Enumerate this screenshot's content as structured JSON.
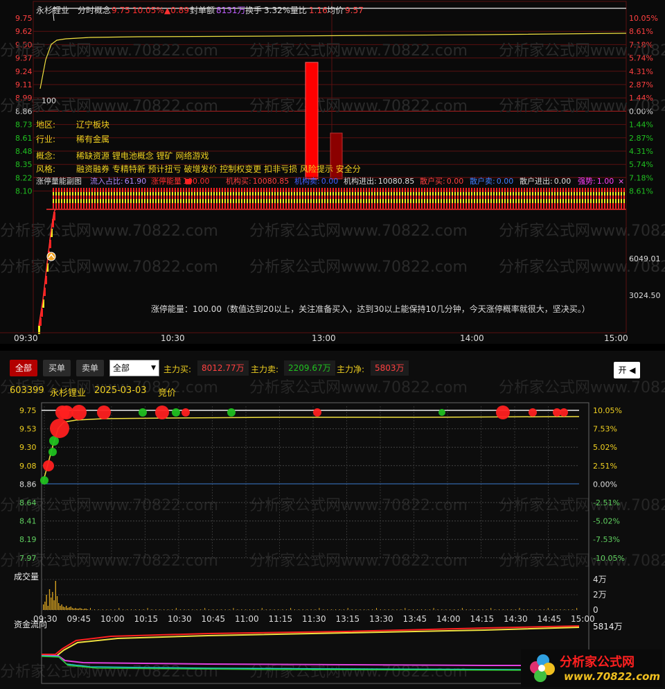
{
  "top": {
    "stock_name": "永杉锂业",
    "mode_label": "分时概念",
    "price": "9.75",
    "pct": "10.05%",
    "change": "▲0.89",
    "seal_label": "封单额",
    "seal_value": "8131万",
    "turnover_label": "换手",
    "turnover_value": "3.32%",
    "vol_ratio_label": "量比",
    "vol_ratio_value": "1.16",
    "avg_label": "均价",
    "avg_value": "9.57",
    "left_ticks": [
      "9.75",
      "9.62",
      "9.50",
      "9.37",
      "9.24",
      "9.11",
      "8.99",
      "8.86",
      "8.73",
      "8.61",
      "8.48",
      "8.35",
      "8.22",
      "8.10"
    ],
    "right_ticks": [
      "10.05%",
      "8.61%",
      "7.18%",
      "5.74%",
      "4.31%",
      "2.87%",
      "1.44%",
      "0.00%",
      "1.44%",
      "2.87%",
      "4.31%",
      "5.74%",
      "7.18%",
      "8.61%"
    ],
    "label_100": "100",
    "info_rows": [
      {
        "key": "地区:",
        "value": "辽宁板块"
      },
      {
        "key": "行业:",
        "value": "稀有金属"
      },
      {
        "key": "概念:",
        "value": "稀缺资源 锂电池概念 锂矿 网络游戏"
      },
      {
        "key": "风格:",
        "value": "融资融券 专精特新 预计扭亏 破增发价 控制权变更 扣非亏损 风险提示 安全分"
      }
    ],
    "sub_title": "涨停量能副图",
    "sub_items": [
      {
        "label": "流入占比:",
        "value": "61.90",
        "color": "#b08aff"
      },
      {
        "label": "涨停能量",
        "value": "100.00",
        "color": "#ff3030"
      },
      {
        "label": "机构买:",
        "value": "10080.85",
        "color": "#ff4040"
      },
      {
        "label": "机构卖:",
        "value": "0.00",
        "color": "#4060ff"
      },
      {
        "label": "机构进出:",
        "value": "10080.85",
        "color": "#dddddd"
      },
      {
        "label": "散户买:",
        "value": "0.00",
        "color": "#ff4040"
      },
      {
        "label": "散户卖:",
        "value": "0.00",
        "color": "#4080ff"
      },
      {
        "label": "散户进出:",
        "value": "0.00",
        "color": "#dddddd"
      },
      {
        "label": "强势:",
        "value": "1.00",
        "color": "#ff40ff"
      }
    ],
    "sub_right_ticks": [
      "6049.01",
      "3024.50"
    ],
    "energy_note": "涨停能量：100.00（数值达到20以上，关注准备买入，达到30以上能保持10几分钟，今天涨停概率就很大，坚决买。）",
    "time_ticks": [
      "09:30",
      "10:30",
      "13:00",
      "14:00",
      "15:00"
    ]
  },
  "bottom": {
    "tabs": [
      "全部",
      "买单",
      "卖单"
    ],
    "select_value": "全部",
    "main_buy_label": "主力买:",
    "main_buy_value": "8012.77万",
    "main_sell_label": "主力卖:",
    "main_sell_value": "2209.67万",
    "main_net_label": "主力净:",
    "main_net_value": "5803万",
    "open_button": "开",
    "code": "603399",
    "name": "永杉锂业",
    "date": "2025-03-03",
    "auction": "竞价",
    "left_ticks": [
      "9.75",
      "9.53",
      "9.30",
      "9.08",
      "8.86",
      "8.64",
      "8.41",
      "8.19",
      "7.97"
    ],
    "right_ticks": [
      "10.05%",
      "7.53%",
      "5.02%",
      "2.51%",
      "0.00%",
      "-2.51%",
      "-5.02%",
      "-7.53%",
      "-10.05%"
    ],
    "vol_label": "成交量",
    "vol_ticks": [
      "4万",
      "2万",
      "0"
    ],
    "time_ticks": [
      "09:30",
      "09:45",
      "10:00",
      "10:15",
      "10:30",
      "10:45",
      "11:00",
      "11:15",
      "11:30",
      "13:15",
      "13:30",
      "13:45",
      "14:00",
      "14:15",
      "14:30",
      "14:45",
      "15:00"
    ],
    "flow_label": "资金流向",
    "flow_value": "5814万",
    "watermark": "分析家公式网www.70822.com",
    "logo_text": "分析家公式网",
    "logo_url": "www.70822.com"
  },
  "colors": {
    "up": "#ff3030",
    "down": "#20c020",
    "yellow": "#f0d020",
    "grid_red": "#7a1010"
  }
}
